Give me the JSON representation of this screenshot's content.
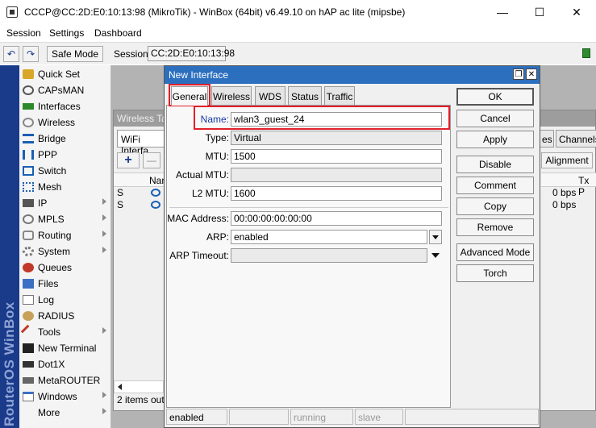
{
  "window": {
    "title": "CCCP@CC:2D:E0:10:13:98 (MikroTik) - WinBox (64bit) v6.49.10 on hAP ac lite (mipsbe)",
    "minimize": "—",
    "maximize": "☐",
    "close": "✕"
  },
  "menu": [
    "Session",
    "Settings",
    "Dashboard"
  ],
  "toolbar": {
    "undo": "↶",
    "redo": "↷",
    "safe_mode": "Safe Mode",
    "session_label": "Session:",
    "session_value": "CC:2D:E0:10:13:98"
  },
  "banner": "RouterOS WinBox",
  "sidebar": [
    {
      "label": "Quick Set",
      "icon": "quickset-icon",
      "arrow": false
    },
    {
      "label": "CAPsMAN",
      "icon": "capsman-icon",
      "arrow": false
    },
    {
      "label": "Interfaces",
      "icon": "interfaces-icon",
      "arrow": false
    },
    {
      "label": "Wireless",
      "icon": "wireless-icon",
      "arrow": false
    },
    {
      "label": "Bridge",
      "icon": "bridge-icon",
      "arrow": false
    },
    {
      "label": "PPP",
      "icon": "ppp-icon",
      "arrow": false
    },
    {
      "label": "Switch",
      "icon": "switch-icon",
      "arrow": false
    },
    {
      "label": "Mesh",
      "icon": "mesh-icon",
      "arrow": false
    },
    {
      "label": "IP",
      "icon": "ip-icon",
      "arrow": true
    },
    {
      "label": "MPLS",
      "icon": "mpls-icon",
      "arrow": true
    },
    {
      "label": "Routing",
      "icon": "routing-icon",
      "arrow": true
    },
    {
      "label": "System",
      "icon": "system-icon",
      "arrow": true
    },
    {
      "label": "Queues",
      "icon": "queues-icon",
      "arrow": false
    },
    {
      "label": "Files",
      "icon": "files-icon",
      "arrow": false
    },
    {
      "label": "Log",
      "icon": "log-icon",
      "arrow": false
    },
    {
      "label": "RADIUS",
      "icon": "radius-icon",
      "arrow": false
    },
    {
      "label": "Tools",
      "icon": "tools-icon",
      "arrow": true
    },
    {
      "label": "New Terminal",
      "icon": "terminal-icon",
      "arrow": false
    },
    {
      "label": "Dot1X",
      "icon": "dot1x-icon",
      "arrow": false
    },
    {
      "label": "MetaROUTER",
      "icon": "metarouter-icon",
      "arrow": false
    },
    {
      "label": "Windows",
      "icon": "windows-icon",
      "arrow": true
    },
    {
      "label": "More",
      "icon": "",
      "arrow": true
    }
  ],
  "wireless_tables": {
    "title": "Wireless Tab",
    "tab_wifi": "WiFi Interfa",
    "tab_es": "es",
    "tab_channels": "Channels",
    "add": "+",
    "remove": "—",
    "alignment": "Alignment",
    "col_name": "Nam",
    "col_txp": "Tx P",
    "rows": [
      {
        "flag": "S",
        "bps": "0 bps"
      },
      {
        "flag": "S",
        "bps": "0 bps"
      }
    ],
    "items": "2 items out o"
  },
  "dialog": {
    "title": "New Interface",
    "restore": "❐",
    "close": "✕",
    "tabs": [
      "General",
      "Wireless",
      "WDS",
      "Status",
      "Traffic"
    ],
    "fields": {
      "name_label": "Name:",
      "name_value": "wlan3_guest_24",
      "type_label": "Type:",
      "type_value": "Virtual",
      "mtu_label": "MTU:",
      "mtu_value": "1500",
      "actual_mtu_label": "Actual MTU:",
      "actual_mtu_value": "",
      "l2mtu_label": "L2 MTU:",
      "l2mtu_value": "1600",
      "mac_label": "MAC Address:",
      "mac_value": "00:00:00:00:00:00",
      "arp_label": "ARP:",
      "arp_value": "enabled",
      "arp_timeout_label": "ARP Timeout:",
      "arp_timeout_value": ""
    },
    "buttons": [
      "OK",
      "Cancel",
      "Apply",
      "Disable",
      "Comment",
      "Copy",
      "Remove",
      "Advanced Mode",
      "Torch"
    ],
    "status": {
      "state": "enabled",
      "running": "running",
      "slave": "slave"
    }
  },
  "colors": {
    "dialog_title": "#2c6fbf",
    "banner": "#1a3a8a",
    "highlight": "#e0202a"
  }
}
